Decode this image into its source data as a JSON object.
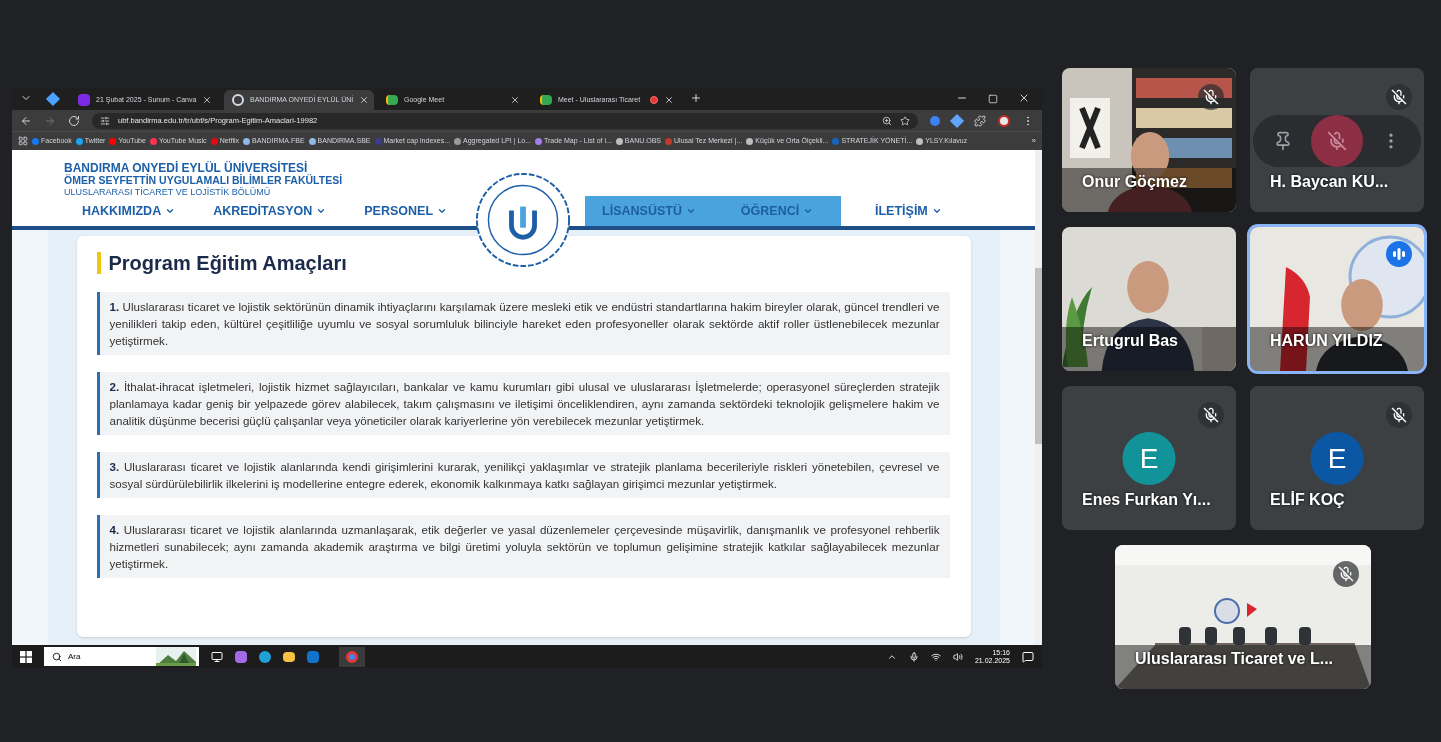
{
  "browser": {
    "tabs": [
      {
        "title": "21 Şubat 2025 - Sunum - Canva",
        "selected": false,
        "kind": "canva"
      },
      {
        "title": "BANDIRMA ONYEDİ EYLÜL ÜNİ",
        "selected": true,
        "kind": "site"
      },
      {
        "title": "Google Meet",
        "selected": false,
        "kind": "meet"
      },
      {
        "title": "Meet - Uluslararası Ticaret",
        "selected": false,
        "kind": "meet_recording"
      }
    ],
    "address": "ubf.bandirma.edu.tr/tr/ubf/s/Program-Egitim-Amaclari-19982",
    "bookmarks": [
      {
        "label": "Facebook",
        "color": "#1877f2"
      },
      {
        "label": "Twitter",
        "color": "#1da1f2"
      },
      {
        "label": "YouTube",
        "color": "#ff0000"
      },
      {
        "label": "YouTube Music",
        "color": "#ff3355"
      },
      {
        "label": "Netflix",
        "color": "#e50914"
      },
      {
        "label": "BANDIRMA.FBE",
        "color": "#8fb8e8"
      },
      {
        "label": "BANDIRMA.SBE",
        "color": "#8fb8e8"
      },
      {
        "label": "Market cap indexes...",
        "color": "#3b3b8f"
      },
      {
        "label": "Aggregated LPI | Lo...",
        "color": "#9a9a9a"
      },
      {
        "label": "Trade Map - List of i...",
        "color": "#a37cf0"
      },
      {
        "label": "BANU.OBS",
        "color": "#bdbdbd"
      },
      {
        "label": "Ulusal Tez Merkezi |...",
        "color": "#c0392b"
      },
      {
        "label": "Küçük ve Orta Ölçekli...",
        "color": "#bdbdbd"
      },
      {
        "label": "STRATEJİK YÖNETİ...",
        "color": "#1565c0"
      },
      {
        "label": "YLSY.Kılavuz",
        "color": "#bdbdbd"
      }
    ],
    "bookmarks_more": "»"
  },
  "site": {
    "header_lines": [
      "BANDIRMA ONYEDİ EYLÜL ÜNİVERSİTESİ",
      "ÖMER SEYFETTİN UYGULAMALI BİLİMLER FAKÜLTESİ",
      "ULUSLARARASI TİCARET VE LOJİSTİK BÖLÜMÜ"
    ],
    "nav_left": [
      {
        "label": "HAKKIMIZDA",
        "highlighted": false
      },
      {
        "label": "AKREDİTASYON",
        "highlighted": false
      },
      {
        "label": "PERSONEL",
        "highlighted": false
      }
    ],
    "nav_right": [
      {
        "label": "LİSANSÜSTÜ",
        "highlighted": true
      },
      {
        "label": "ÖĞRENCİ",
        "highlighted": true
      },
      {
        "label": "İLETİŞİM",
        "highlighted": false
      }
    ],
    "title": "Program Eğitim Amaçları",
    "objectives": [
      {
        "number": "1.",
        "text": "Uluslararası ticaret ve lojistik sektörünün dinamik ihtiyaçlarını karşılamak üzere mesleki etik ve endüstri standartlarına hakim bireyler olarak, güncel trendleri ve yenilikleri takip eden, kültürel çeşitliliğe uyumlu ve sosyal sorumluluk bilinciyle hareket eden profesyoneller olarak sektörde aktif roller üstlenebilecek mezunlar yetiştirmek."
      },
      {
        "number": "2.",
        "text": "İthalat-ihracat işletmeleri, lojistik hizmet sağlayıcıları, bankalar ve kamu kurumları gibi ulusal ve uluslararası İşletmelerde; operasyonel süreçlerden stratejik planlamaya kadar geniş bir yelpazede görev alabilecek, takım çalışmasını ve iletişimi önceliklendiren, aynı zamanda sektördeki teknolojik gelişmelere hakim ve analitik düşünme becerisi güçlü çalışanlar veya yöneticiler olarak kariyerlerine yön verebilecek mezunlar yetiştirmek."
      },
      {
        "number": "3.",
        "text": "Uluslararası ticaret ve lojistik alanlarında kendi girişimlerini kurarak, yenilikçi yaklaşımlar ve stratejik planlama becerileriyle riskleri yönetebilen, çevresel ve sosyal sürdürülebilirlik ilkelerini iş modellerine entegre ederek, ekonomik kalkınmaya katkı sağlayan girişimci mezunlar yetiştirmek."
      },
      {
        "number": "4.",
        "text": "Uluslararası ticaret ve lojistik alanlarında uzmanlaşarak, etik değerler ve yasal düzenlemeler çerçevesinde müşavirlik, danışmanlık ve profesyonel rehberlik hizmetleri sunabilecek; aynı zamanda akademik araştırma ve bilgi üretimi yoluyla sektörün ve toplumun gelişimine stratejik katkılar sağlayabilecek mezunlar yetiştirmek."
      }
    ]
  },
  "taskbar": {
    "search_placeholder": "Ara",
    "time": "15:16",
    "date": "21.02.2025"
  },
  "participants": [
    {
      "name": "Onur Göçmez",
      "kind": "video",
      "muted": true,
      "speaking": false
    },
    {
      "name": "H. Baycan KU...",
      "kind": "controls",
      "muted": true,
      "speaking": false
    },
    {
      "name": "Ertugrul Bas",
      "kind": "video",
      "muted": false,
      "speaking": false
    },
    {
      "name": "HARUN YILDIZ",
      "kind": "video",
      "muted": false,
      "speaking": true
    },
    {
      "name": "Enes Furkan Yı...",
      "kind": "avatar",
      "initial": "E",
      "color": "#12939a",
      "muted": true,
      "speaking": false
    },
    {
      "name": "ELİF KOÇ",
      "kind": "avatar",
      "initial": "E",
      "color": "#0b57a4",
      "muted": true,
      "speaking": false
    },
    {
      "name": "Uluslararası Ticaret ve L...",
      "kind": "video",
      "muted": true,
      "speaking": false
    }
  ]
}
